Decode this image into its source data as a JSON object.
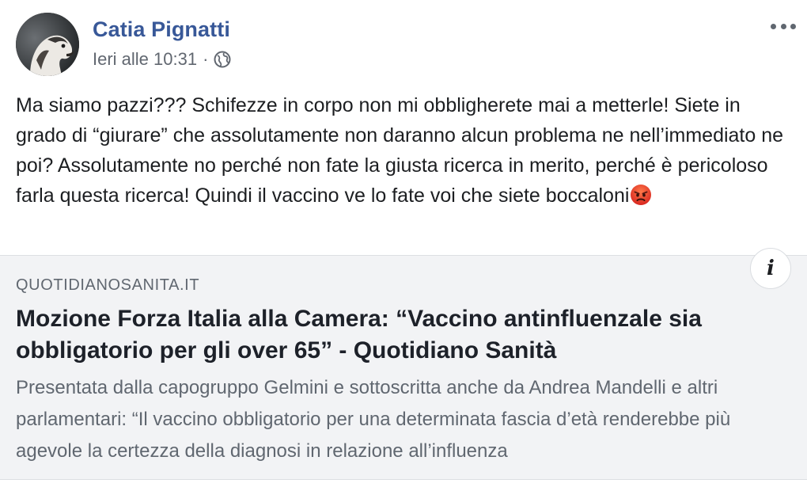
{
  "post": {
    "author": "Catia Pignatti",
    "timestamp": "Ieri alle 10:31",
    "separator": "·",
    "privacy_icon": "globe-icon",
    "more_icon": "more-options-icon",
    "text": "Ma siamo pazzi??? Schifezze in corpo non mi obbligherete mai a metterle! Siete in grado di “giurare” che assolutamente non daranno alcun problema ne nell’immediato ne poi? Assolutamente no perché non fate la giusta ricerca in merito, perché è pericoloso farla questa ricerca! Quindi il vaccino ve lo fate voi che siete boccaloni",
    "emoji": "angry-face-emoji"
  },
  "link_preview": {
    "domain": "QUOTIDIANOSANITA.IT",
    "headline": "Mozione Forza Italia alla Camera: “Vaccino antinfluenzale sia obbligatorio per gli over 65” - Quotidiano Sanità",
    "description": "Presentata dalla capogruppo Gelmini e sottoscritta anche da Andrea Mandelli e altri parlamentari: “Il vaccino obbligatorio per una determinata fascia d’età renderebbe più agevole la certezza della diagnosi in relazione all’influenza",
    "info_label": "i"
  },
  "colors": {
    "author_link": "#385898",
    "meta_text": "#616770",
    "card_background": "#f2f3f5",
    "emoji_red": "#e0312a"
  }
}
